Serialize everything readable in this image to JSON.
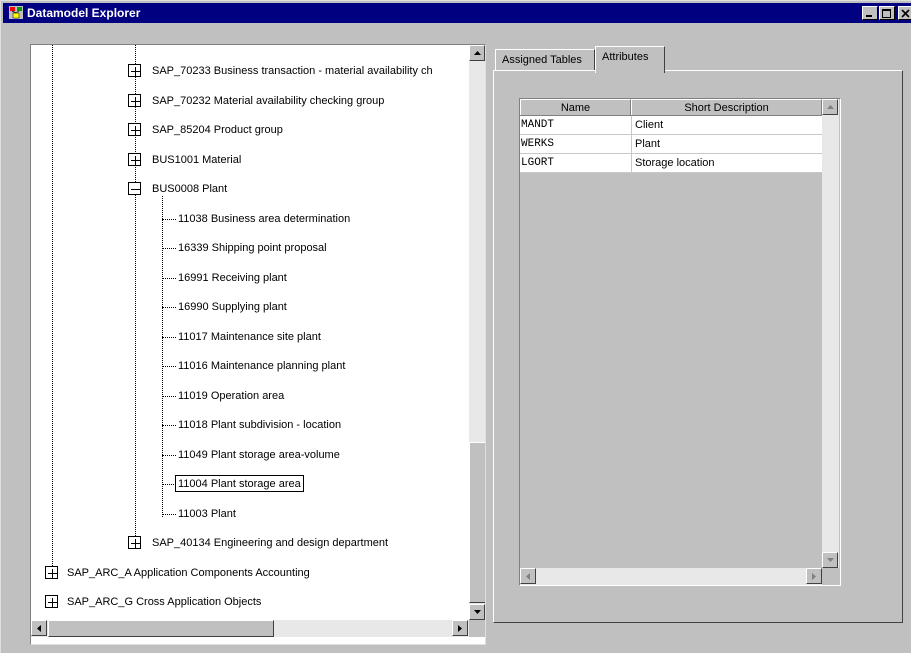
{
  "window": {
    "title": "Datamodel Explorer"
  },
  "tree": {
    "nodes": [
      {
        "id": "SAP_70233",
        "label": "SAP_70233  Business transaction - material availability ch"
      },
      {
        "id": "SAP_70232",
        "label": "SAP_70232  Material availability checking group"
      },
      {
        "id": "SAP_85204",
        "label": "SAP_85204  Product group"
      },
      {
        "id": "BUS1001",
        "label": "BUS1001  Material"
      },
      {
        "id": "BUS0008",
        "label": "BUS0008  Plant"
      },
      {
        "id": "11038",
        "label": "11038  Business area determination"
      },
      {
        "id": "16339",
        "label": "16339  Shipping point proposal"
      },
      {
        "id": "16991",
        "label": "16991  Receiving plant"
      },
      {
        "id": "16990",
        "label": "16990  Supplying plant"
      },
      {
        "id": "11017",
        "label": "11017  Maintenance site plant"
      },
      {
        "id": "11016",
        "label": "11016  Maintenance planning plant"
      },
      {
        "id": "11019",
        "label": "11019  Operation area"
      },
      {
        "id": "11018",
        "label": "11018  Plant subdivision - location"
      },
      {
        "id": "11049",
        "label": "11049  Plant storage area-volume"
      },
      {
        "id": "11004",
        "label": "11004  Plant storage area"
      },
      {
        "id": "11003",
        "label": "11003  Plant"
      },
      {
        "id": "SAP_40134",
        "label": "SAP_40134  Engineering and design department"
      },
      {
        "id": "SAP_ARC_A",
        "label": "SAP_ARC_A  Application Components Accounting"
      },
      {
        "id": "SAP_ARC_G",
        "label": "SAP_ARC_G  Cross Application Objects"
      }
    ],
    "selected": "11004"
  },
  "tabs": [
    {
      "label": "Assigned Tables",
      "active": false
    },
    {
      "label": "Attributes",
      "active": true
    }
  ],
  "attributes_table": {
    "columns": [
      "Name",
      "Short Description"
    ],
    "rows": [
      {
        "name": "MANDT",
        "description": "Client"
      },
      {
        "name": "WERKS",
        "description": "Plant"
      },
      {
        "name": "LGORT",
        "description": "Storage location"
      }
    ]
  }
}
